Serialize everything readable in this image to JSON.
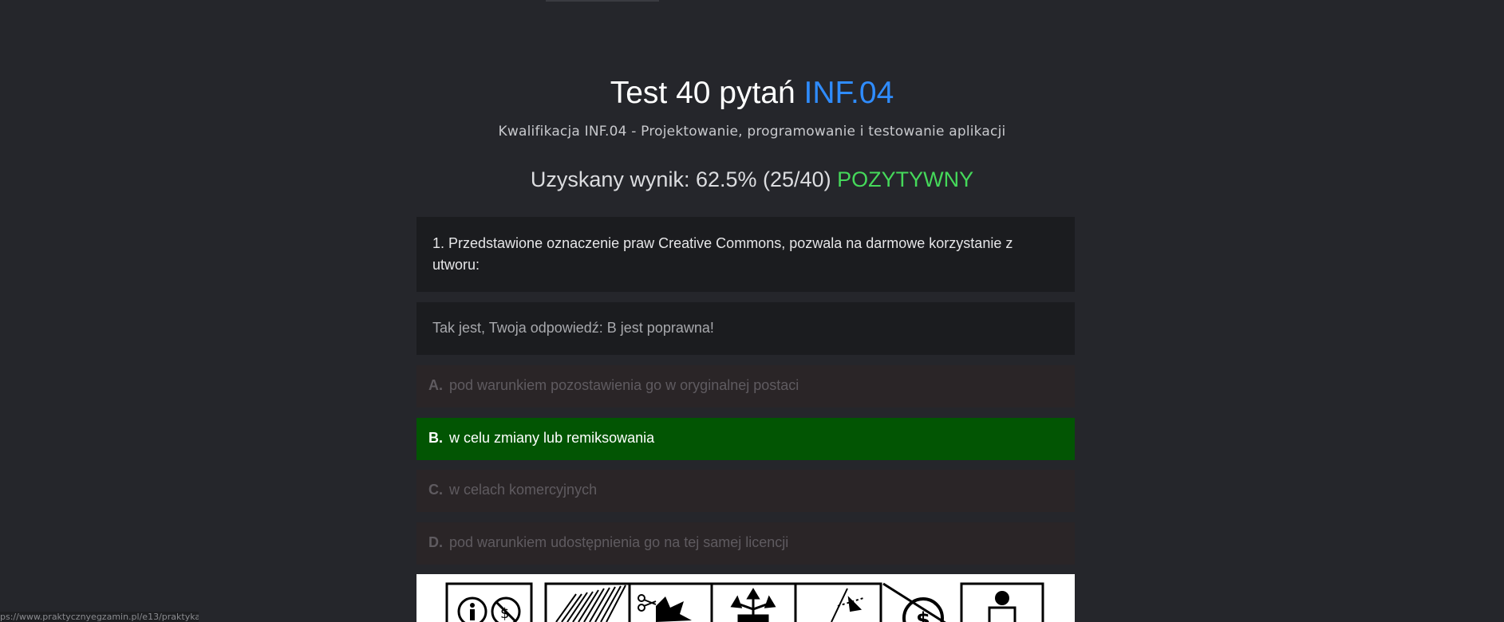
{
  "header": {
    "title_main": "Test 40 pytań ",
    "title_accent": "INF.04",
    "subtitle": "Kwalifikacja INF.04 - Projektowanie, programowanie i testowanie aplikacji"
  },
  "result": {
    "label": "Uzyskany wynik: 62.5% (25/40) ",
    "status": "POZYTYWNY"
  },
  "question": {
    "text": "1. Przedstawione oznaczenie praw Creative Commons, pozwala na darmowe korzystanie z utworu:"
  },
  "feedback": {
    "text": "Tak jest, Twoja odpowiedź: B jest poprawna!"
  },
  "answers": [
    {
      "letter": "A.",
      "text": "pod warunkiem pozostawienia go w oryginalnej postaci"
    },
    {
      "letter": "B.",
      "text": "w celu zmiany lub remiksowania"
    },
    {
      "letter": "C.",
      "text": "w celach komercyjnych"
    },
    {
      "letter": "D.",
      "text": "pod warunkiem udostępnienia go na tej samej licencji"
    }
  ],
  "colors": {
    "background": "#25262b",
    "accent": "#2f8cff",
    "positive": "#45d85a",
    "correct_answer": "#025503"
  },
  "status_bar": {
    "url": "ps://www.praktycznyegzamin.pl/e13/praktyka/"
  }
}
